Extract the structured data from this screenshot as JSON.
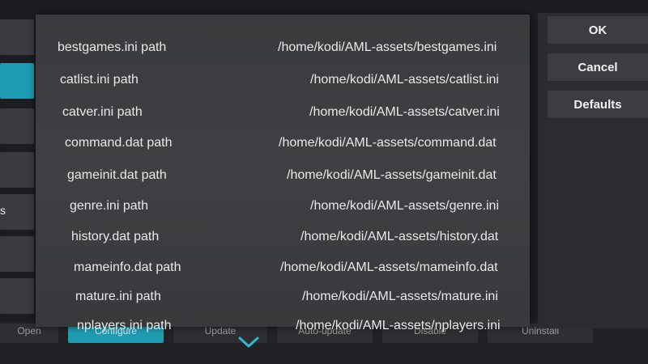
{
  "background": {
    "left_label": "s",
    "bottom_buttons": [
      "Open",
      "Configure",
      "Update",
      "Auto-update",
      "Disable",
      "Uninstall"
    ]
  },
  "dialog": {
    "settings": [
      {
        "name": "bestgames.ini path",
        "value": "/home/kodi/AML-assets/bestgames.ini"
      },
      {
        "name": "catlist.ini path",
        "value": "/home/kodi/AML-assets/catlist.ini"
      },
      {
        "name": "catver.ini path",
        "value": "/home/kodi/AML-assets/catver.ini"
      },
      {
        "name": "command.dat path",
        "value": "/home/kodi/AML-assets/command.dat"
      },
      {
        "name": "gameinit.dat path",
        "value": "/home/kodi/AML-assets/gameinit.dat"
      },
      {
        "name": "genre.ini path",
        "value": "/home/kodi/AML-assets/genre.ini"
      },
      {
        "name": "history.dat path",
        "value": "/home/kodi/AML-assets/history.dat"
      },
      {
        "name": "mameinfo.dat path",
        "value": "/home/kodi/AML-assets/mameinfo.dat"
      },
      {
        "name": "mature.ini path",
        "value": "/home/kodi/AML-assets/mature.ini"
      },
      {
        "name": "nplayers.ini path",
        "value": "/home/kodi/AML-assets/nplayers.ini"
      }
    ],
    "buttons": {
      "ok": "OK",
      "cancel": "Cancel",
      "defaults": "Defaults"
    }
  },
  "colors": {
    "accent": "#1f9bb2",
    "dialog_bg": "#3d3e41",
    "text": "#e9e9e9"
  },
  "icons": {
    "more": "chevron-down-icon"
  }
}
